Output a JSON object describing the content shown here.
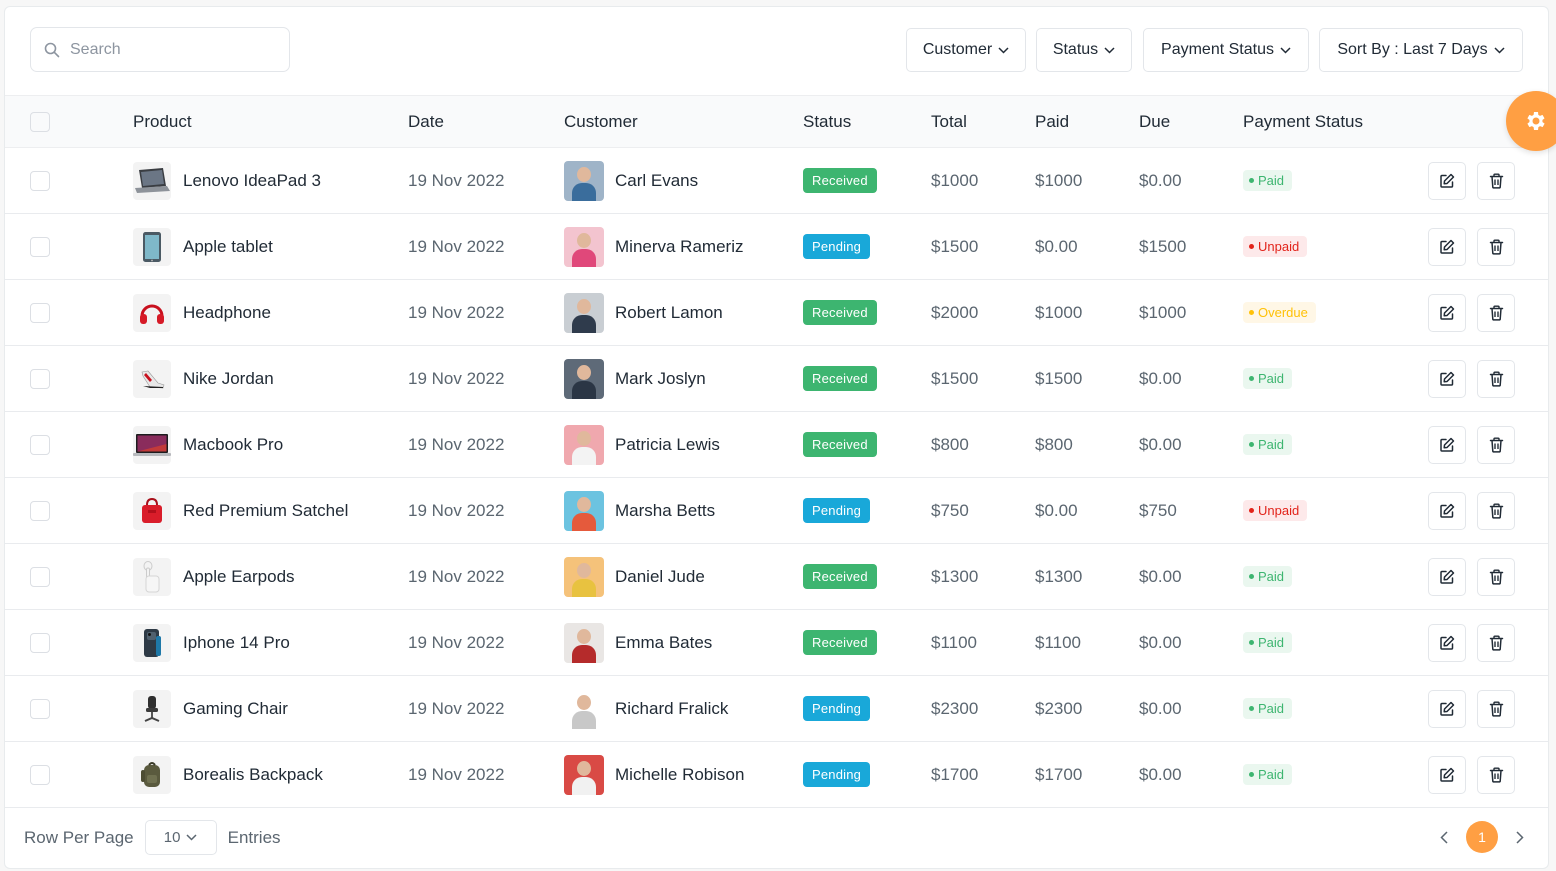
{
  "search": {
    "placeholder": "Search"
  },
  "filters": [
    {
      "label": "Customer"
    },
    {
      "label": "Status"
    },
    {
      "label": "Payment Status"
    },
    {
      "label": "Sort By : Last 7 Days"
    }
  ],
  "columns": {
    "product": "Product",
    "date": "Date",
    "customer": "Customer",
    "status": "Status",
    "total": "Total",
    "paid": "Paid",
    "due": "Due",
    "payment_status": "Payment Status"
  },
  "rows": [
    {
      "product": "Lenovo IdeaPad 3",
      "product_icon": "laptop-icon",
      "date": "19 Nov 2022",
      "customer": "Carl Evans",
      "status": "Received",
      "total": "$1000",
      "paid": "$1000",
      "due": "$0.00",
      "payment_status": "Paid"
    },
    {
      "product": "Apple tablet",
      "product_icon": "tablet-icon",
      "date": "19 Nov 2022",
      "customer": "Minerva Rameriz",
      "status": "Pending",
      "total": "$1500",
      "paid": "$0.00",
      "due": "$1500",
      "payment_status": "Unpaid"
    },
    {
      "product": "Headphone",
      "product_icon": "headphone-icon",
      "date": "19 Nov 2022",
      "customer": "Robert Lamon",
      "status": "Received",
      "total": "$2000",
      "paid": "$1000",
      "due": "$1000",
      "payment_status": "Overdue"
    },
    {
      "product": "Nike Jordan",
      "product_icon": "shoe-icon",
      "date": "19 Nov 2022",
      "customer": "Mark Joslyn",
      "status": "Received",
      "total": "$1500",
      "paid": "$1500",
      "due": "$0.00",
      "payment_status": "Paid"
    },
    {
      "product": "Macbook Pro",
      "product_icon": "macbook-icon",
      "date": "19 Nov 2022",
      "customer": "Patricia Lewis",
      "status": "Received",
      "total": "$800",
      "paid": "$800",
      "due": "$0.00",
      "payment_status": "Paid"
    },
    {
      "product": "Red Premium Satchel",
      "product_icon": "satchel-icon",
      "date": "19 Nov 2022",
      "customer": "Marsha Betts",
      "status": "Pending",
      "total": "$750",
      "paid": "$0.00",
      "due": "$750",
      "payment_status": "Unpaid"
    },
    {
      "product": "Apple Earpods",
      "product_icon": "earpods-icon",
      "date": "19 Nov 2022",
      "customer": "Daniel Jude",
      "status": "Received",
      "total": "$1300",
      "paid": "$1300",
      "due": "$0.00",
      "payment_status": "Paid"
    },
    {
      "product": "Iphone 14 Pro",
      "product_icon": "phone-icon",
      "date": "19 Nov 2022",
      "customer": "Emma Bates",
      "status": "Received",
      "total": "$1100",
      "paid": "$1100",
      "due": "$0.00",
      "payment_status": "Paid"
    },
    {
      "product": "Gaming Chair",
      "product_icon": "chair-icon",
      "date": "19 Nov 2022",
      "customer": "Richard Fralick",
      "status": "Pending",
      "total": "$2300",
      "paid": "$2300",
      "due": "$0.00",
      "payment_status": "Paid"
    },
    {
      "product": "Borealis Backpack",
      "product_icon": "backpack-icon",
      "date": "19 Nov 2022",
      "customer": "Michelle Robison",
      "status": "Pending",
      "total": "$1700",
      "paid": "$1700",
      "due": "$0.00",
      "payment_status": "Paid"
    }
  ],
  "footer": {
    "rows_label": "Row Per Page",
    "rows_value": "10",
    "entries_label": "Entries",
    "current_page": "1"
  },
  "colors": {
    "accent": "#ff9f43",
    "received": "#3db570",
    "pending": "#19a8d9",
    "paid": "#3db570",
    "unpaid": "#e2231a",
    "overdue": "#ffc107"
  },
  "avatar_colors": [
    {
      "bg": "#9fb4c8",
      "shirt": "#3a6d9c"
    },
    {
      "bg": "#f3c4cf",
      "shirt": "#e0487a"
    },
    {
      "bg": "#c9ced3",
      "shirt": "#2f3b4c"
    },
    {
      "bg": "#5e6a78",
      "shirt": "#2b3645"
    },
    {
      "bg": "#f0a8ae",
      "shirt": "#f3f3f3"
    },
    {
      "bg": "#6cc3e0",
      "shirt": "#e55a3c"
    },
    {
      "bg": "#f5c27a",
      "shirt": "#e8c240"
    },
    {
      "bg": "#e9e6e4",
      "shirt": "#b52b2b"
    },
    {
      "bg": "#ffffff",
      "shirt": "#c8c8c8"
    },
    {
      "bg": "#d94a45",
      "shirt": "#f1f1f1"
    }
  ]
}
